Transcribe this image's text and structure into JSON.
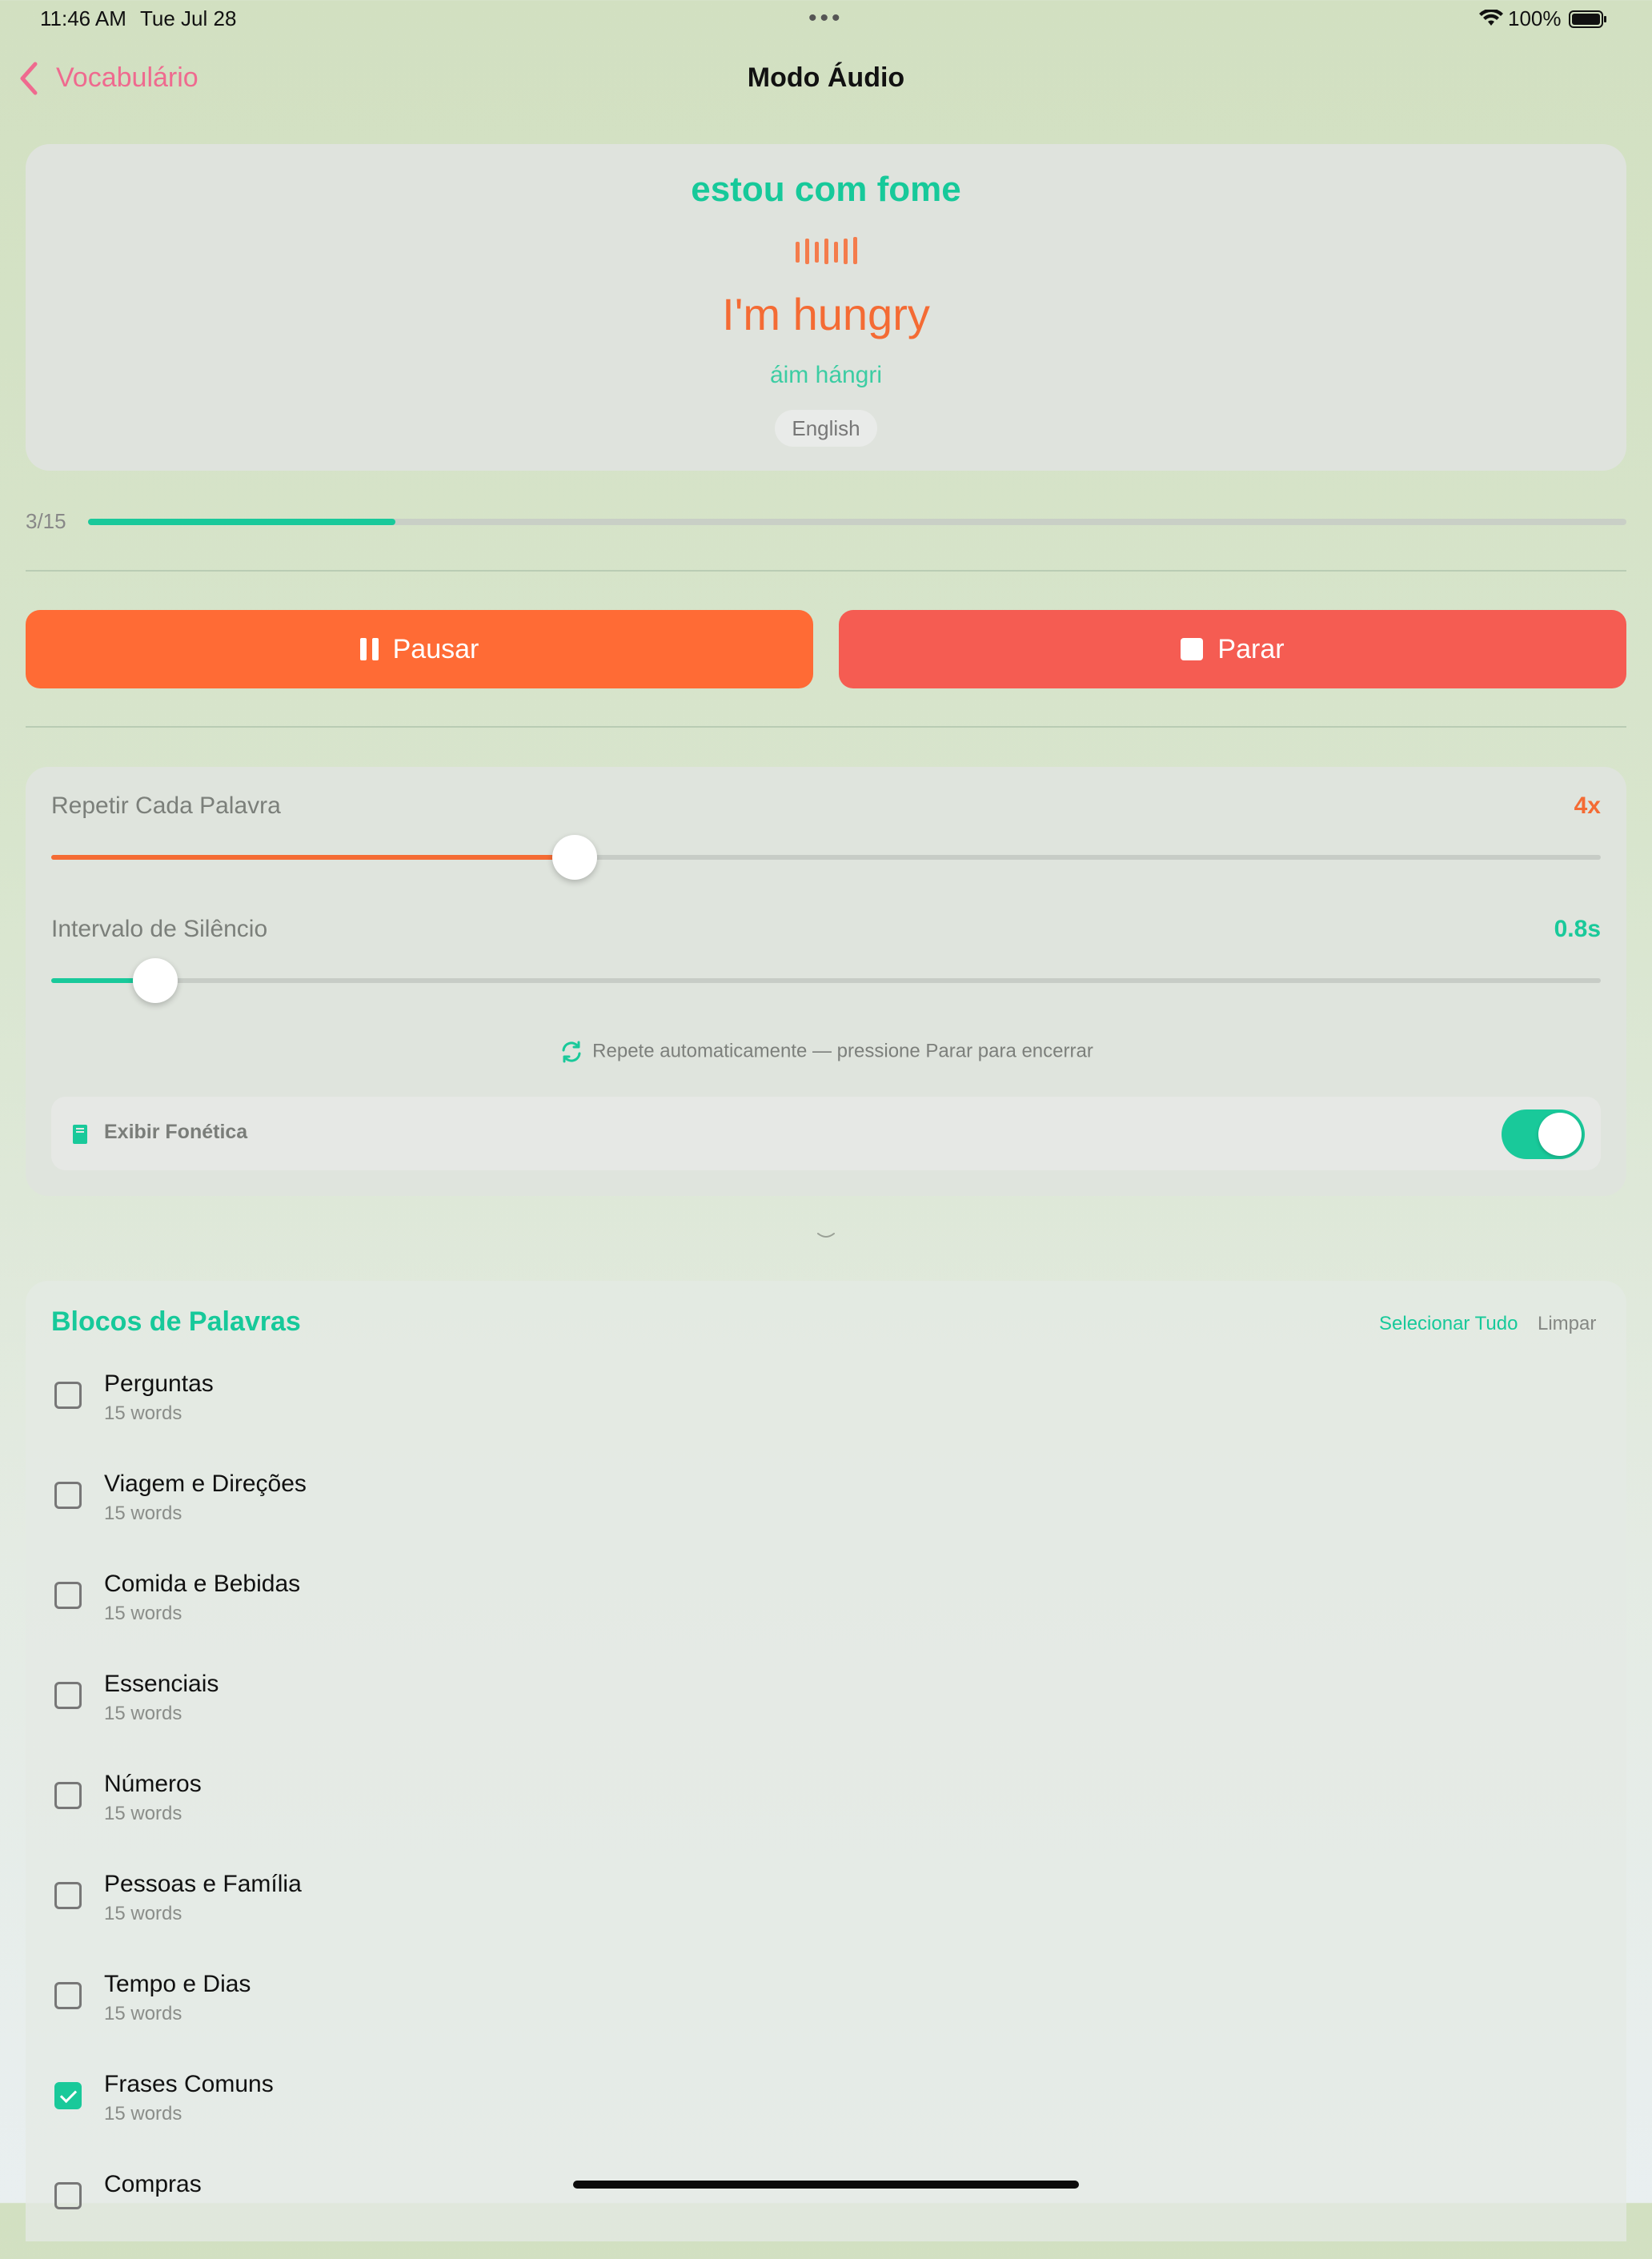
{
  "status_bar": {
    "time": "11:46 AM",
    "date": "Tue Jul 28",
    "battery": "100%"
  },
  "nav": {
    "back_label": "Vocabulário",
    "title": "Modo Áudio"
  },
  "card": {
    "phrase": "estou com fome",
    "translation": "I'm hungry",
    "phonetic": "áim hángri",
    "language": "English"
  },
  "progress": {
    "label": "3/15",
    "fraction": 0.2
  },
  "buttons": {
    "pause_label": "Pausar",
    "stop_label": "Parar"
  },
  "settings": {
    "repeat_label": "Repetir Cada Palavra",
    "repeat_value": "4x",
    "repeat_fraction": 0.338,
    "silence_label": "Intervalo de Silêncio",
    "silence_value": "0.8s",
    "silence_fraction": 0.067,
    "auto_repeat_note": "Repete automaticamente — pressione Parar para encerrar",
    "phonetics_label": "Exibir Fonética",
    "phonetics_enabled": true
  },
  "blocks": {
    "title": "Blocos de Palavras",
    "select_all": "Selecionar Tudo",
    "clear": "Limpar",
    "items": [
      {
        "name": "Perguntas",
        "count": "15 words",
        "checked": false
      },
      {
        "name": "Viagem e Direções",
        "count": "15 words",
        "checked": false
      },
      {
        "name": "Comida e Bebidas",
        "count": "15 words",
        "checked": false
      },
      {
        "name": "Essenciais",
        "count": "15 words",
        "checked": false
      },
      {
        "name": "Números",
        "count": "15 words",
        "checked": false
      },
      {
        "name": "Pessoas e Família",
        "count": "15 words",
        "checked": false
      },
      {
        "name": "Tempo e Dias",
        "count": "15 words",
        "checked": false
      },
      {
        "name": "Frases Comuns",
        "count": "15 words",
        "checked": true
      },
      {
        "name": "Compras",
        "count": "",
        "checked": false
      }
    ]
  },
  "colors": {
    "accent_green": "#19c99a",
    "accent_orange": "#ff6b35",
    "stop_red": "#f55c52",
    "back_pink": "#ef6a8f"
  },
  "icons": [
    "chevron-left-icon",
    "wifi-icon",
    "battery-icon",
    "waveform-icon",
    "pause-icon",
    "stop-icon",
    "repeat-icon",
    "book-icon",
    "chevron-down-icon"
  ]
}
